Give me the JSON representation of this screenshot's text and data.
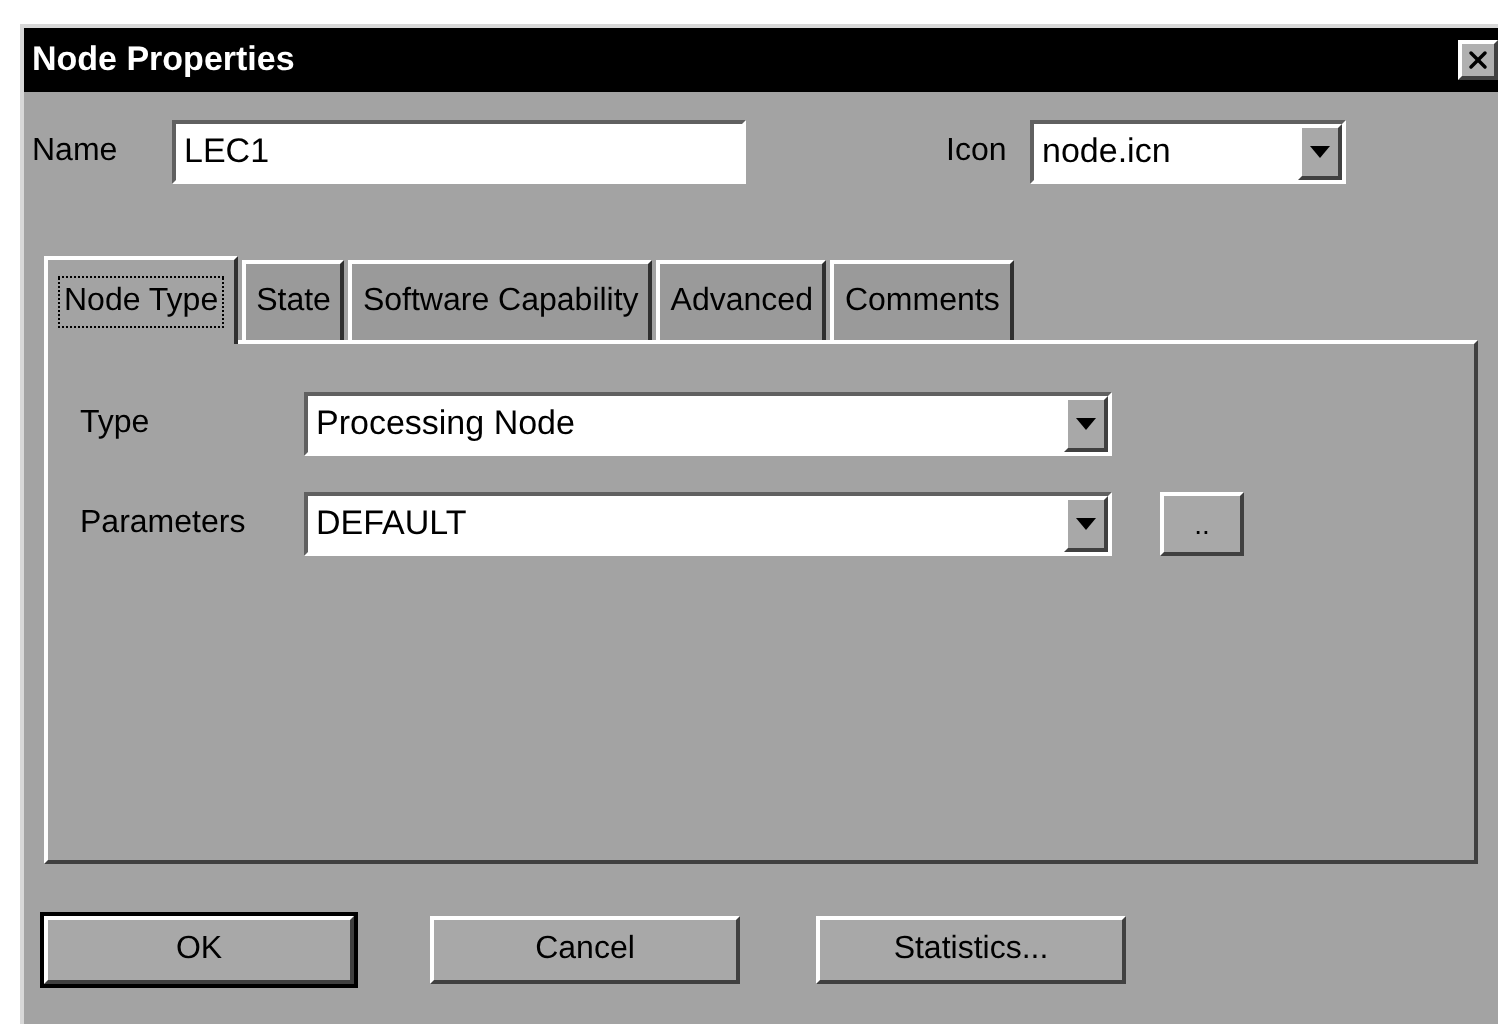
{
  "window": {
    "title": "Node Properties"
  },
  "name_field": {
    "label": "Name",
    "value": "LEC1"
  },
  "icon_field": {
    "label": "Icon",
    "value": "node.icn"
  },
  "tabs": [
    {
      "label": "Node Type",
      "selected": true
    },
    {
      "label": "State",
      "selected": false
    },
    {
      "label": "Software Capability",
      "selected": false
    },
    {
      "label": "Advanced",
      "selected": false
    },
    {
      "label": "Comments",
      "selected": false
    }
  ],
  "fields": [
    {
      "label": "Type",
      "value": "Processing Node"
    },
    {
      "label": "Parameters",
      "value": "DEFAULT",
      "browse_label": ".."
    }
  ],
  "buttons": [
    {
      "label": "OK",
      "default": true
    },
    {
      "label": "Cancel",
      "default": false
    },
    {
      "label": "Statistics...",
      "default": false
    }
  ]
}
